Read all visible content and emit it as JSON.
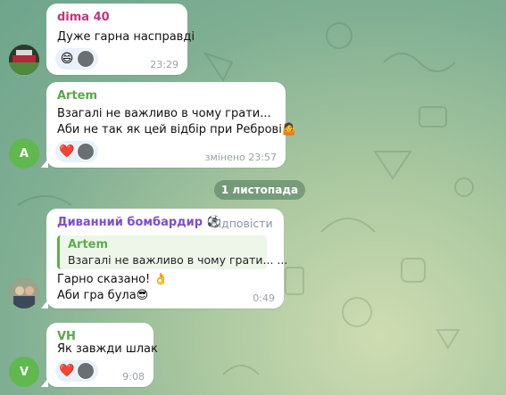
{
  "messages": [
    {
      "sender": "dima 40",
      "sender_color": "#c0367e",
      "lines": [
        "Дуже гарна насправді"
      ],
      "time": "23:29",
      "reaction_emoji": "😄",
      "avatar_icon": "stadium-photo-avatar"
    },
    {
      "sender": "Artem",
      "sender_color": "#58a84a",
      "lines": [
        "Взагалі не важливо в чому грати...",
        "Аби не так як цей відбір при Реброві"
      ],
      "line_emoji": "🤷",
      "time": "змінено 23:57",
      "reaction_emoji": "❤️",
      "avatar_letter": "A",
      "avatar_color": "#5fb94e"
    },
    {
      "sender": "Диванний бомбардир",
      "sender_emoji": "⚽",
      "sender_color": "#7b4fd0",
      "reply_action": "Відповісти",
      "quote_name": "Artem",
      "quote_text": "Взагалі не важливо в чому грати... ...",
      "lines": [
        "Гарно сказано!",
        "Аби гра була"
      ],
      "line1_emoji": "👌",
      "line2_emoji": "😎",
      "time": "0:49",
      "avatar_icon": "people-photo-avatar"
    },
    {
      "sender": "VH",
      "sender_color": "#58a84a",
      "lines": [
        "Як завжди шлак"
      ],
      "time": "9:08",
      "reaction_emoji": "❤️",
      "avatar_letter": "V",
      "avatar_color": "#5fb94e"
    }
  ],
  "date_separator": "1 листопада"
}
